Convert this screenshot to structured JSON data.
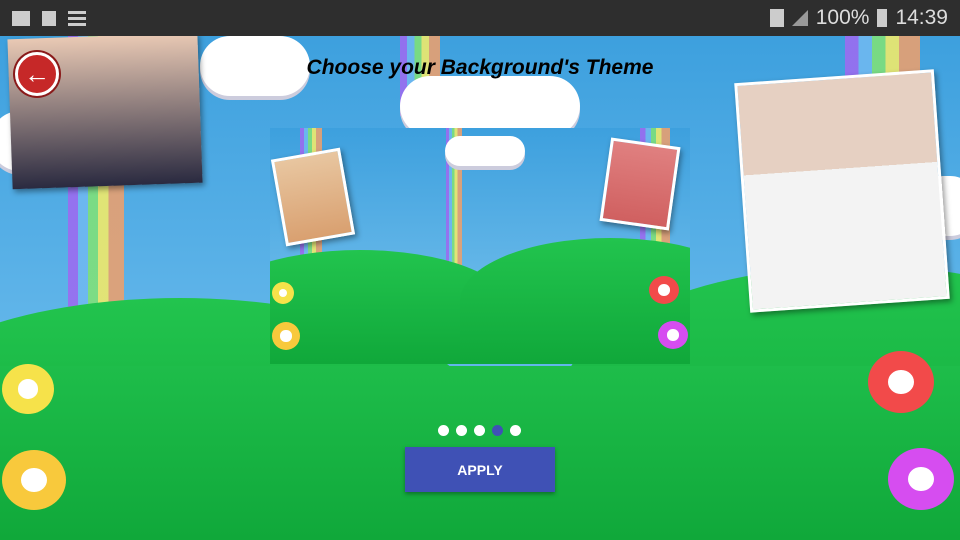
{
  "status_bar": {
    "battery": "100%",
    "time": "14:39",
    "left_icons": [
      "gmail-icon",
      "gallery-icon",
      "list-icon"
    ],
    "right_icons": [
      "wifi-icon",
      "signal-icon",
      "battery-icon"
    ]
  },
  "header": {
    "title": "Choose your Background's Theme",
    "back_icon": "arrow-left-icon"
  },
  "pager": {
    "count": 5,
    "active_index": 3
  },
  "apply_label": "APPLY",
  "colors": {
    "accent": "#3f51b5",
    "back_button": "#c62828",
    "grass": "#1ebd4a",
    "sky": "#3b9fdf"
  }
}
